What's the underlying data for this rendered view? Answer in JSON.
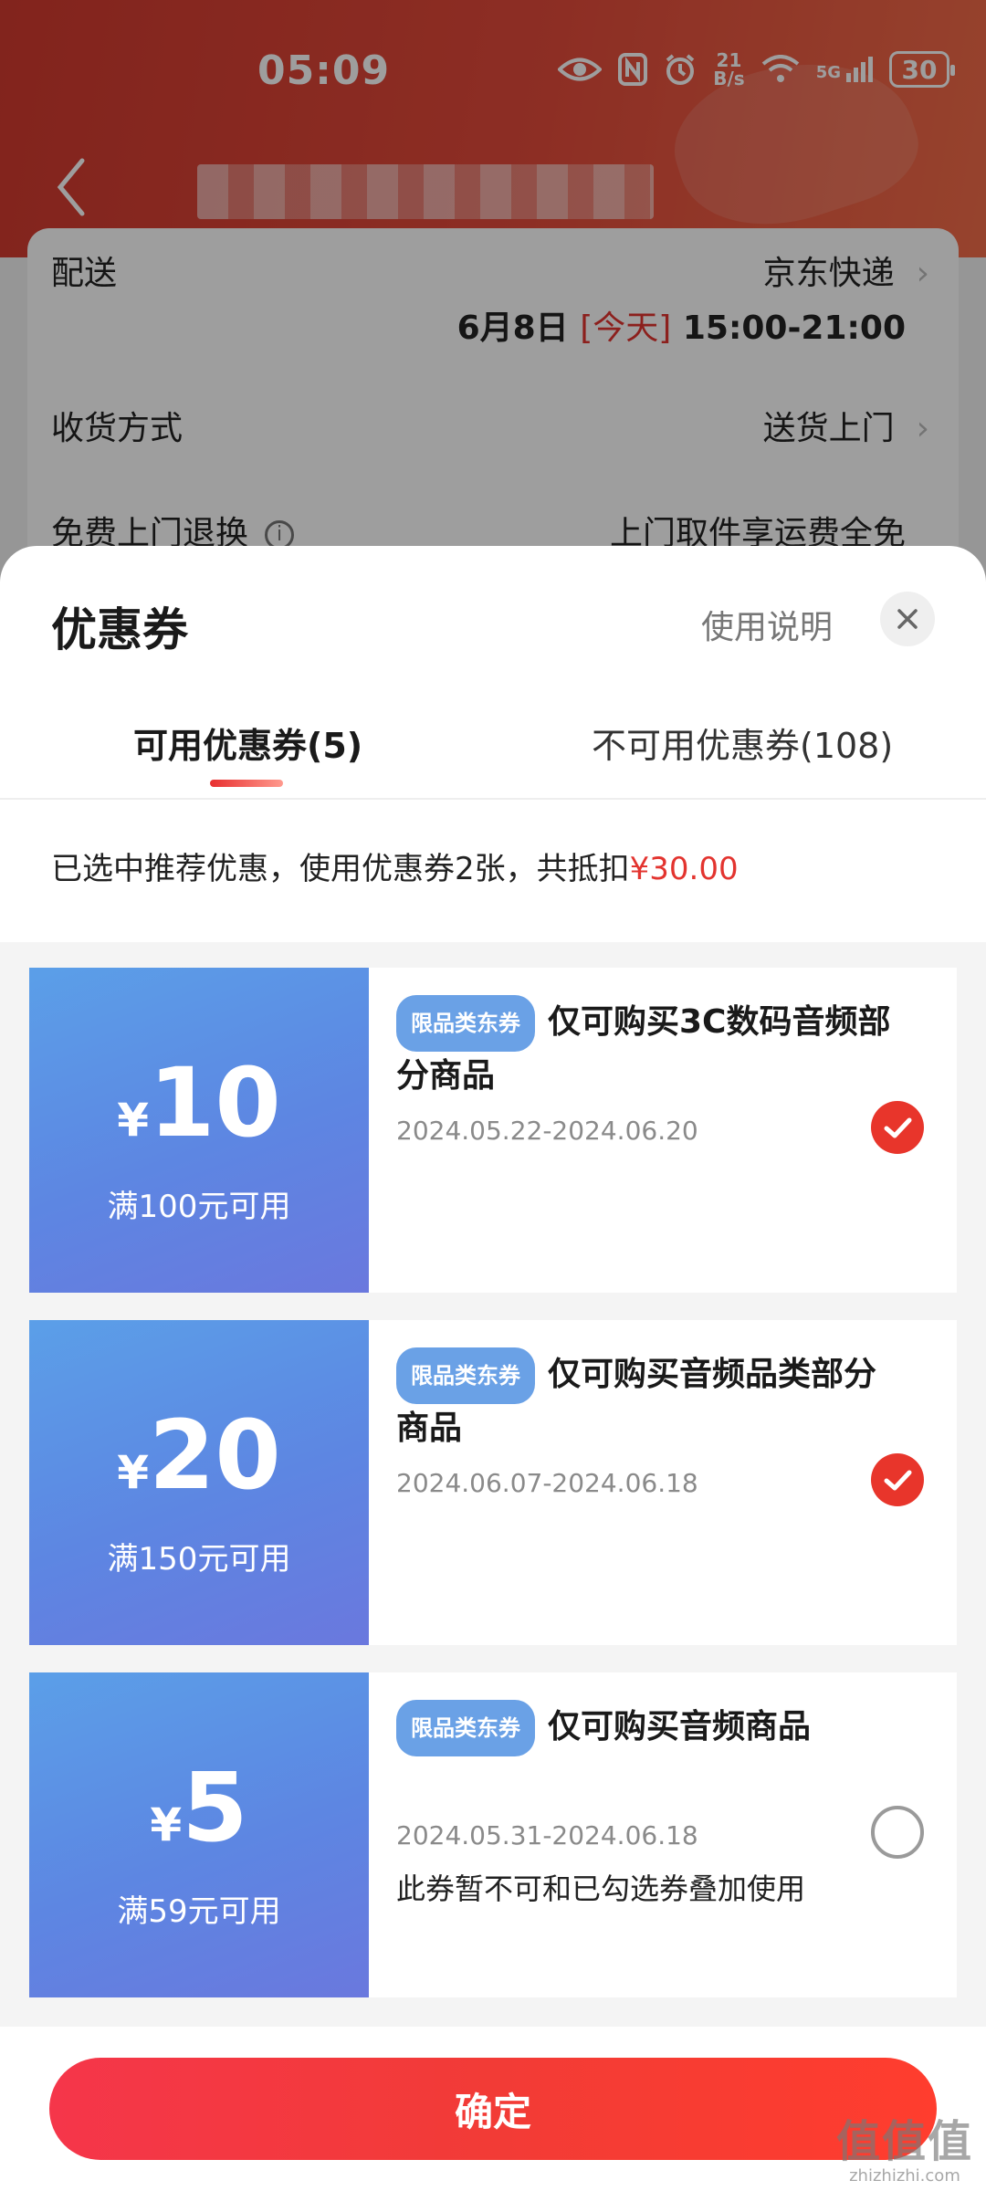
{
  "status_bar": {
    "time": "05:09",
    "net_speed_top": "21",
    "net_speed_bottom": "B/s",
    "network": "5G",
    "battery": "30"
  },
  "background_page": {
    "rows": [
      {
        "label": "配送",
        "value": "京东快递",
        "sub_date": "6月8日",
        "sub_today": "[今天]",
        "sub_time": "15:00-21:00"
      },
      {
        "label": "收货方式",
        "value": "送货上门"
      },
      {
        "label": "免费上门退换",
        "value": "上门取件享运费全免"
      }
    ]
  },
  "sheet": {
    "title": "优惠券",
    "usage_link": "使用说明",
    "tabs": [
      {
        "label": "可用优惠券(5)"
      },
      {
        "label": "不可用优惠券(108)"
      }
    ],
    "summary": {
      "prefix": "已选中推荐优惠，使用优惠券2张，共抵扣",
      "amount": "¥30.00"
    },
    "coupons": [
      {
        "yen": "¥",
        "amount": "10",
        "threshold": "满100元可用",
        "tag": "限品类东券",
        "title": "仅可购买3C数码音频部分商品",
        "date": "2024.05.22-2024.06.20",
        "note": "",
        "checked": true
      },
      {
        "yen": "¥",
        "amount": "20",
        "threshold": "满150元可用",
        "tag": "限品类东券",
        "title": "仅可购买音频品类部分商品",
        "date": "2024.06.07-2024.06.18",
        "note": "",
        "checked": true
      },
      {
        "yen": "¥",
        "amount": "5",
        "threshold": "满59元可用",
        "tag": "限品类东券",
        "title": "仅可购买音频商品",
        "date": "2024.05.31-2024.06.18",
        "note": "此券暂不可和已勾选券叠加使用",
        "checked": false
      }
    ],
    "confirm_label": "确定"
  },
  "watermark": {
    "main": "值值值",
    "sub": "zhizhizhi.com"
  },
  "colors": {
    "accent_red": "#e8352b",
    "coupon_blue": "#5d86e2",
    "tag_blue": "#6aa1e6"
  }
}
